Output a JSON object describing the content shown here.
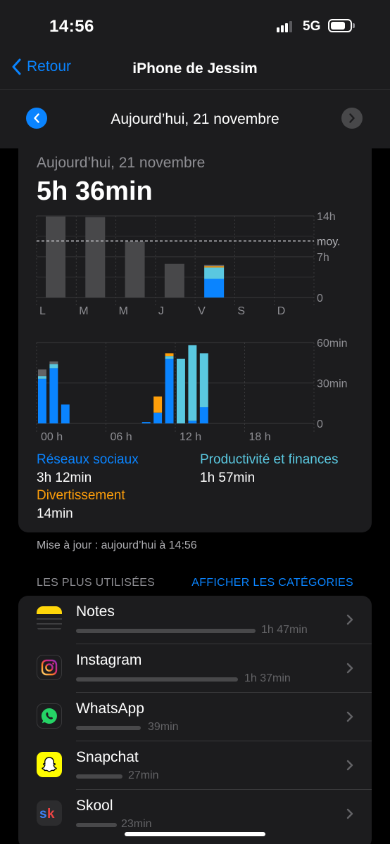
{
  "status": {
    "time": "14:56",
    "network": "5G",
    "signal_bars": 3
  },
  "nav": {
    "back_label": "Retour",
    "title": "iPhone de Jessim"
  },
  "date_header": {
    "label": "Aujourd’hui, 21 novembre"
  },
  "summary": {
    "date": "Aujourd’hui, 21 novembre",
    "total": "5h 36min"
  },
  "colors": {
    "social": "#0a84ff",
    "productivity": "#5ac8e0",
    "entertainment": "#ff9f0a",
    "other": "#636366",
    "past_days": "#48484a"
  },
  "chart_data": [
    {
      "type": "bar",
      "categories": [
        "L",
        "M",
        "M",
        "J",
        "V",
        "S",
        "D"
      ],
      "y_ticks": [
        "14h",
        "7h",
        "0"
      ],
      "average_label": "moy.",
      "ylim": [
        0,
        14
      ],
      "average": 9.7,
      "series": [
        {
          "values": [
            13.9,
            13.8,
            9.6,
            5.8,
            0,
            0,
            0
          ]
        },
        {
          "values": [
            0,
            0,
            0,
            0,
            3.2,
            0,
            0
          ]
        },
        {
          "values": [
            0,
            0,
            0,
            0,
            1.95,
            0,
            0
          ]
        },
        {
          "values": [
            0,
            0,
            0,
            0,
            0.23,
            0,
            0
          ]
        },
        {
          "values": [
            0,
            0,
            0,
            0,
            0.2,
            0,
            0
          ]
        }
      ]
    },
    {
      "type": "bar",
      "x_ticks": [
        "00 h",
        "06 h",
        "12 h",
        "18 h"
      ],
      "y_ticks": [
        "60min",
        "30min",
        "0"
      ],
      "ylim": [
        0,
        60
      ],
      "x": [
        0,
        1,
        2,
        3,
        4,
        5,
        6,
        7,
        8,
        9,
        10,
        11,
        12,
        13,
        14,
        15,
        16,
        17,
        18,
        19,
        20,
        21,
        22,
        23
      ],
      "series": [
        {
          "values": [
            33,
            41,
            14,
            0,
            0,
            0,
            0,
            0,
            0,
            1,
            8,
            48,
            0,
            2,
            12,
            0,
            0,
            0,
            0,
            0,
            0,
            0,
            0,
            0
          ]
        },
        {
          "values": [
            2,
            3,
            0,
            0,
            0,
            0,
            0,
            0,
            0,
            0,
            0,
            2,
            48,
            56,
            40,
            0,
            0,
            0,
            0,
            0,
            0,
            0,
            0,
            0
          ]
        },
        {
          "values": [
            0,
            0,
            0,
            0,
            0,
            0,
            0,
            0,
            0,
            0,
            12,
            2,
            0,
            0,
            0,
            0,
            0,
            0,
            0,
            0,
            0,
            0,
            0,
            0
          ]
        },
        {
          "values": [
            5,
            2,
            0,
            0,
            0,
            0,
            0,
            0,
            0,
            0,
            0,
            0,
            0,
            0,
            0,
            0,
            0,
            0,
            0,
            0,
            0,
            0,
            0,
            0
          ]
        }
      ]
    }
  ],
  "legend": {
    "social_label": "Réseaux sociaux",
    "social_value": "3h 12min",
    "productivity_label": "Productivité et finances",
    "productivity_value": "1h 57min",
    "entertainment_label": "Divertissement",
    "entertainment_value": "14min"
  },
  "updated_text": "Mise à jour : aujourd’hui à 14:56",
  "most_used": {
    "title": "LES PLUS UTILISÉES",
    "categories_link": "AFFICHER LES CATÉGORIES"
  },
  "apps": [
    {
      "name": "Notes",
      "usage": "1h 47min",
      "minutes": 107,
      "icon": "notes-icon"
    },
    {
      "name": "Instagram",
      "usage": "1h 37min",
      "minutes": 97,
      "icon": "instagram-icon"
    },
    {
      "name": "WhatsApp",
      "usage": "39min",
      "minutes": 39,
      "icon": "whatsapp-icon"
    },
    {
      "name": "Snapchat",
      "usage": "27min",
      "minutes": 27,
      "icon": "snapchat-icon"
    },
    {
      "name": "Skool",
      "usage": "23min",
      "minutes": 23,
      "icon": "skool-icon"
    }
  ]
}
